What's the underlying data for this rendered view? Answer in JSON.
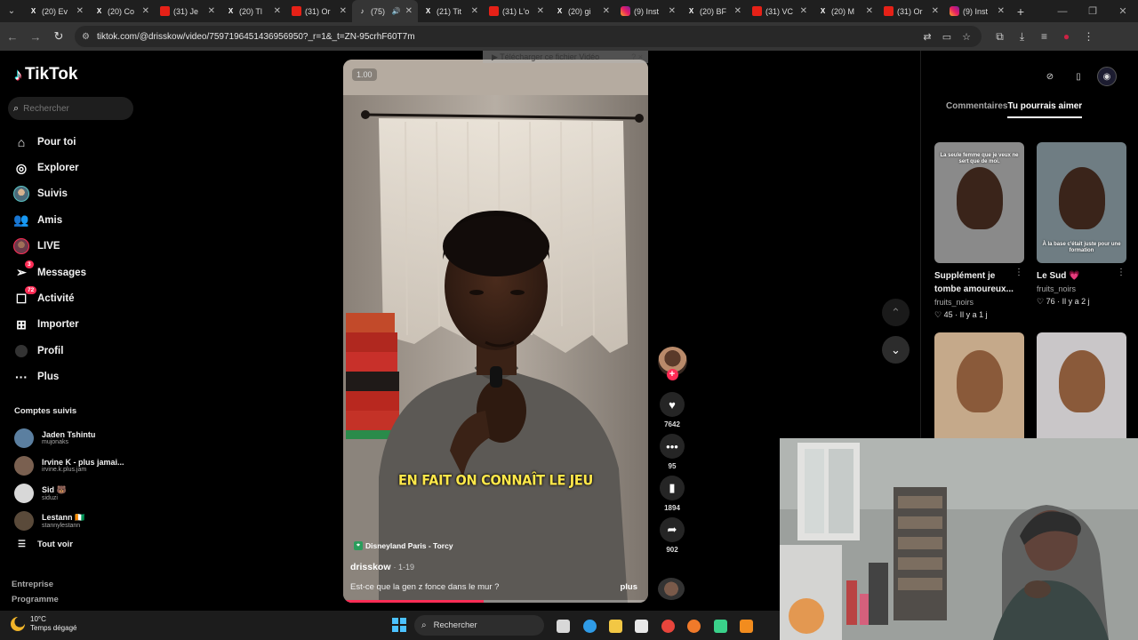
{
  "browser": {
    "tabs": [
      {
        "icon": "x-icon",
        "label": "(20) Ev",
        "active": false
      },
      {
        "icon": "x-icon",
        "label": "(20) Co",
        "active": false
      },
      {
        "icon": "youtube-icon",
        "label": "(31) Je",
        "active": false
      },
      {
        "icon": "x-icon",
        "label": "(20) Tl",
        "active": false
      },
      {
        "icon": "youtube-icon",
        "label": "(31) Or",
        "active": false
      },
      {
        "icon": "tiktok-icon",
        "label": "(75)",
        "active": true
      },
      {
        "icon": "x-icon",
        "label": "(21) Tit",
        "active": false
      },
      {
        "icon": "youtube-icon",
        "label": "(31) L'o",
        "active": false
      },
      {
        "icon": "x-icon",
        "label": "(20) gi",
        "active": false
      },
      {
        "icon": "instagram-icon",
        "label": "(9) Inst",
        "active": false
      },
      {
        "icon": "x-icon",
        "label": "(20) BF",
        "active": false
      },
      {
        "icon": "youtube-icon",
        "label": "(31) VC",
        "active": false
      },
      {
        "icon": "x-icon",
        "label": "(20) M",
        "active": false
      },
      {
        "icon": "youtube-icon",
        "label": "(31) Or",
        "active": false
      },
      {
        "icon": "instagram-icon",
        "label": "(9) Inst",
        "active": false
      }
    ],
    "url": "tiktok.com/@drisskow/video/7597196451436956950?_r=1&_t=ZN-95crhF60T7m"
  },
  "tiktok": {
    "logo": "TikTok",
    "search_placeholder": "Rechercher",
    "nav": [
      {
        "label": "Pour toi",
        "icon": "home-icon",
        "badge": ""
      },
      {
        "label": "Explorer",
        "icon": "compass-icon",
        "badge": ""
      },
      {
        "label": "Suivis",
        "icon": "following-avatar-icon",
        "badge": ""
      },
      {
        "label": "Amis",
        "icon": "friends-icon",
        "badge": ""
      },
      {
        "label": "LIVE",
        "icon": "live-avatar-icon",
        "badge": ""
      },
      {
        "label": "Messages",
        "icon": "send-icon",
        "badge": "3"
      },
      {
        "label": "Activité",
        "icon": "inbox-icon",
        "badge": "72"
      },
      {
        "label": "Importer",
        "icon": "upload-icon",
        "badge": ""
      },
      {
        "label": "Profil",
        "icon": "profile-icon",
        "badge": ""
      },
      {
        "label": "Plus",
        "icon": "more-icon",
        "badge": ""
      }
    ],
    "following_title": "Comptes suivis",
    "following": [
      {
        "name": "Jaden Tshintu",
        "user": "mujonaks",
        "color": "#5b7fa0"
      },
      {
        "name": "Irvine K - plus jamai...",
        "user": "irvine.k.plus.jam",
        "color": "#7a6050"
      },
      {
        "name": "Sid 🐻",
        "user": "siduzi",
        "color": "#d8d8d8"
      },
      {
        "name": "Lestann 🇨🇮",
        "user": "stannylestann",
        "color": "#5a4a3a"
      }
    ],
    "see_all": "Tout voir",
    "footer_links": [
      "Entreprise",
      "Programme"
    ]
  },
  "video": {
    "speed": "1.00",
    "download_banner": "▶ Télécharger ce fichier Vidéo",
    "download_close": "?  ×",
    "overlay_text": "EN FAIT ON CONNAÎT LE JEU",
    "location": "Disneyland Paris - Torcy",
    "author": "drisskow",
    "date": "· 1-19",
    "description": "Est-ce que la gen z fonce dans le mur ?",
    "more": "plus",
    "progress": 0.46
  },
  "actions": {
    "likes": "7642",
    "comments": "95",
    "saves": "1894",
    "shares": "902"
  },
  "right_panel": {
    "tabs": [
      "Commentaires",
      "Tu pourrais aimer"
    ],
    "active_tab": 1,
    "cards": [
      {
        "title": "Supplément je tombe amoureux...",
        "user": "fruits_noirs",
        "likes": "45",
        "age": "Il y a 1 j",
        "thumb_text": "La seule femme que je veux ne sert que de moi.",
        "bg": "#8a8a8a"
      },
      {
        "title": "Le Sud 💗",
        "user": "fruits_noirs",
        "likes": "76",
        "age": "Il y a 2 j",
        "thumb_text": "À la base c'était juste pour une formation",
        "bg": "#6f7d83"
      },
      {
        "title": "",
        "user": "",
        "likes": "",
        "age": "",
        "thumb_text": "",
        "bg": "#c5a98a"
      },
      {
        "title": "",
        "user": "",
        "likes": "",
        "age": "",
        "thumb_text": "",
        "bg": "#c9c6c8"
      }
    ]
  },
  "taskbar": {
    "temperature": "10°C",
    "weather": "Temps dégagé",
    "search": "Rechercher",
    "apps": [
      {
        "icon": "task-view-icon",
        "color": "#d8d8d8"
      },
      {
        "icon": "edge-icon",
        "color": "#2f9be6"
      },
      {
        "icon": "file-explorer-icon",
        "color": "#f2c744"
      },
      {
        "icon": "store-icon",
        "color": "#e8e8e8"
      },
      {
        "icon": "chrome-icon",
        "color": "#e8453c"
      },
      {
        "icon": "firefox-icon",
        "color": "#f07a2a"
      },
      {
        "icon": "app-icon",
        "color": "#3ad18a"
      },
      {
        "icon": "vlc-icon",
        "color": "#f28c1e"
      }
    ]
  }
}
